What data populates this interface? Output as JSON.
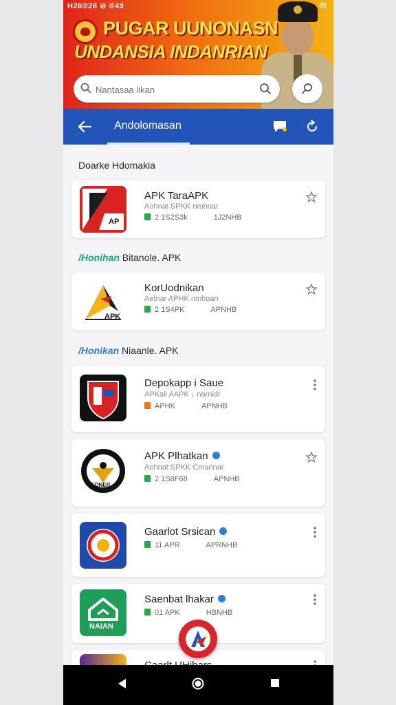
{
  "status": {
    "left": "H28©28 ⊘ ©49",
    "right": "✉"
  },
  "banner": {
    "headline_line1": "PUGAR UUNONASN",
    "headline_line2": "UNDANSIA INDANRIAN"
  },
  "search": {
    "placeholder": "Nantasaa likan"
  },
  "appbar": {
    "title": "Andolomasan"
  },
  "content": {
    "section_title": "Doarke Hdomakia",
    "section_label_1": {
      "accent": "/Honihan",
      "text": "Bitanole. APK"
    },
    "section_label_2": {
      "accent": "/Honikan",
      "text": "Niaanle. APK"
    }
  },
  "apps": [
    {
      "name": "APK TaraAPK",
      "sub": "Aohnat SPKK  nmhoar",
      "dl": "2 1S2S3k",
      "size": "1J2NHB",
      "action": "star",
      "verified": false
    },
    {
      "name": "KorUodnikan",
      "sub": "Aetnar APHK  nmhoan",
      "dl": "2 1S4PK",
      "size": "APNHB",
      "action": "star",
      "verified": false
    },
    {
      "name": "Depokapp i Saue",
      "sub": "APKail AAPK ↓ narnidr",
      "dl": "APHK",
      "size": "APNHB",
      "action": "more",
      "verified": false
    },
    {
      "name": "APK Plhatkan",
      "sub": "Aohnat SPKK  Cmannar",
      "dl": "2 1S8F68",
      "size": "APNHB",
      "action": "star",
      "verified": true
    },
    {
      "name": "Gaarlot Srsican",
      "sub": "",
      "dl": "11 APR",
      "size": "APRNHB",
      "action": "more",
      "verified": true
    },
    {
      "name": "Saenbat lhakar",
      "sub": "",
      "dl": "01 APK",
      "size": "HBNHB",
      "action": "more",
      "verified": true
    },
    {
      "name": "Caarlt UHibars",
      "sub": "",
      "dl": "",
      "size": "",
      "action": "more",
      "verified": false
    }
  ],
  "icons": {
    "app1_label": "AP",
    "app2_label": "APK",
    "app4_label": "EONER",
    "app6_label": "NAIAN"
  },
  "colors": {
    "appbar": "#2354b8",
    "accent": "#1aa67e",
    "fab": "#d8252b"
  }
}
